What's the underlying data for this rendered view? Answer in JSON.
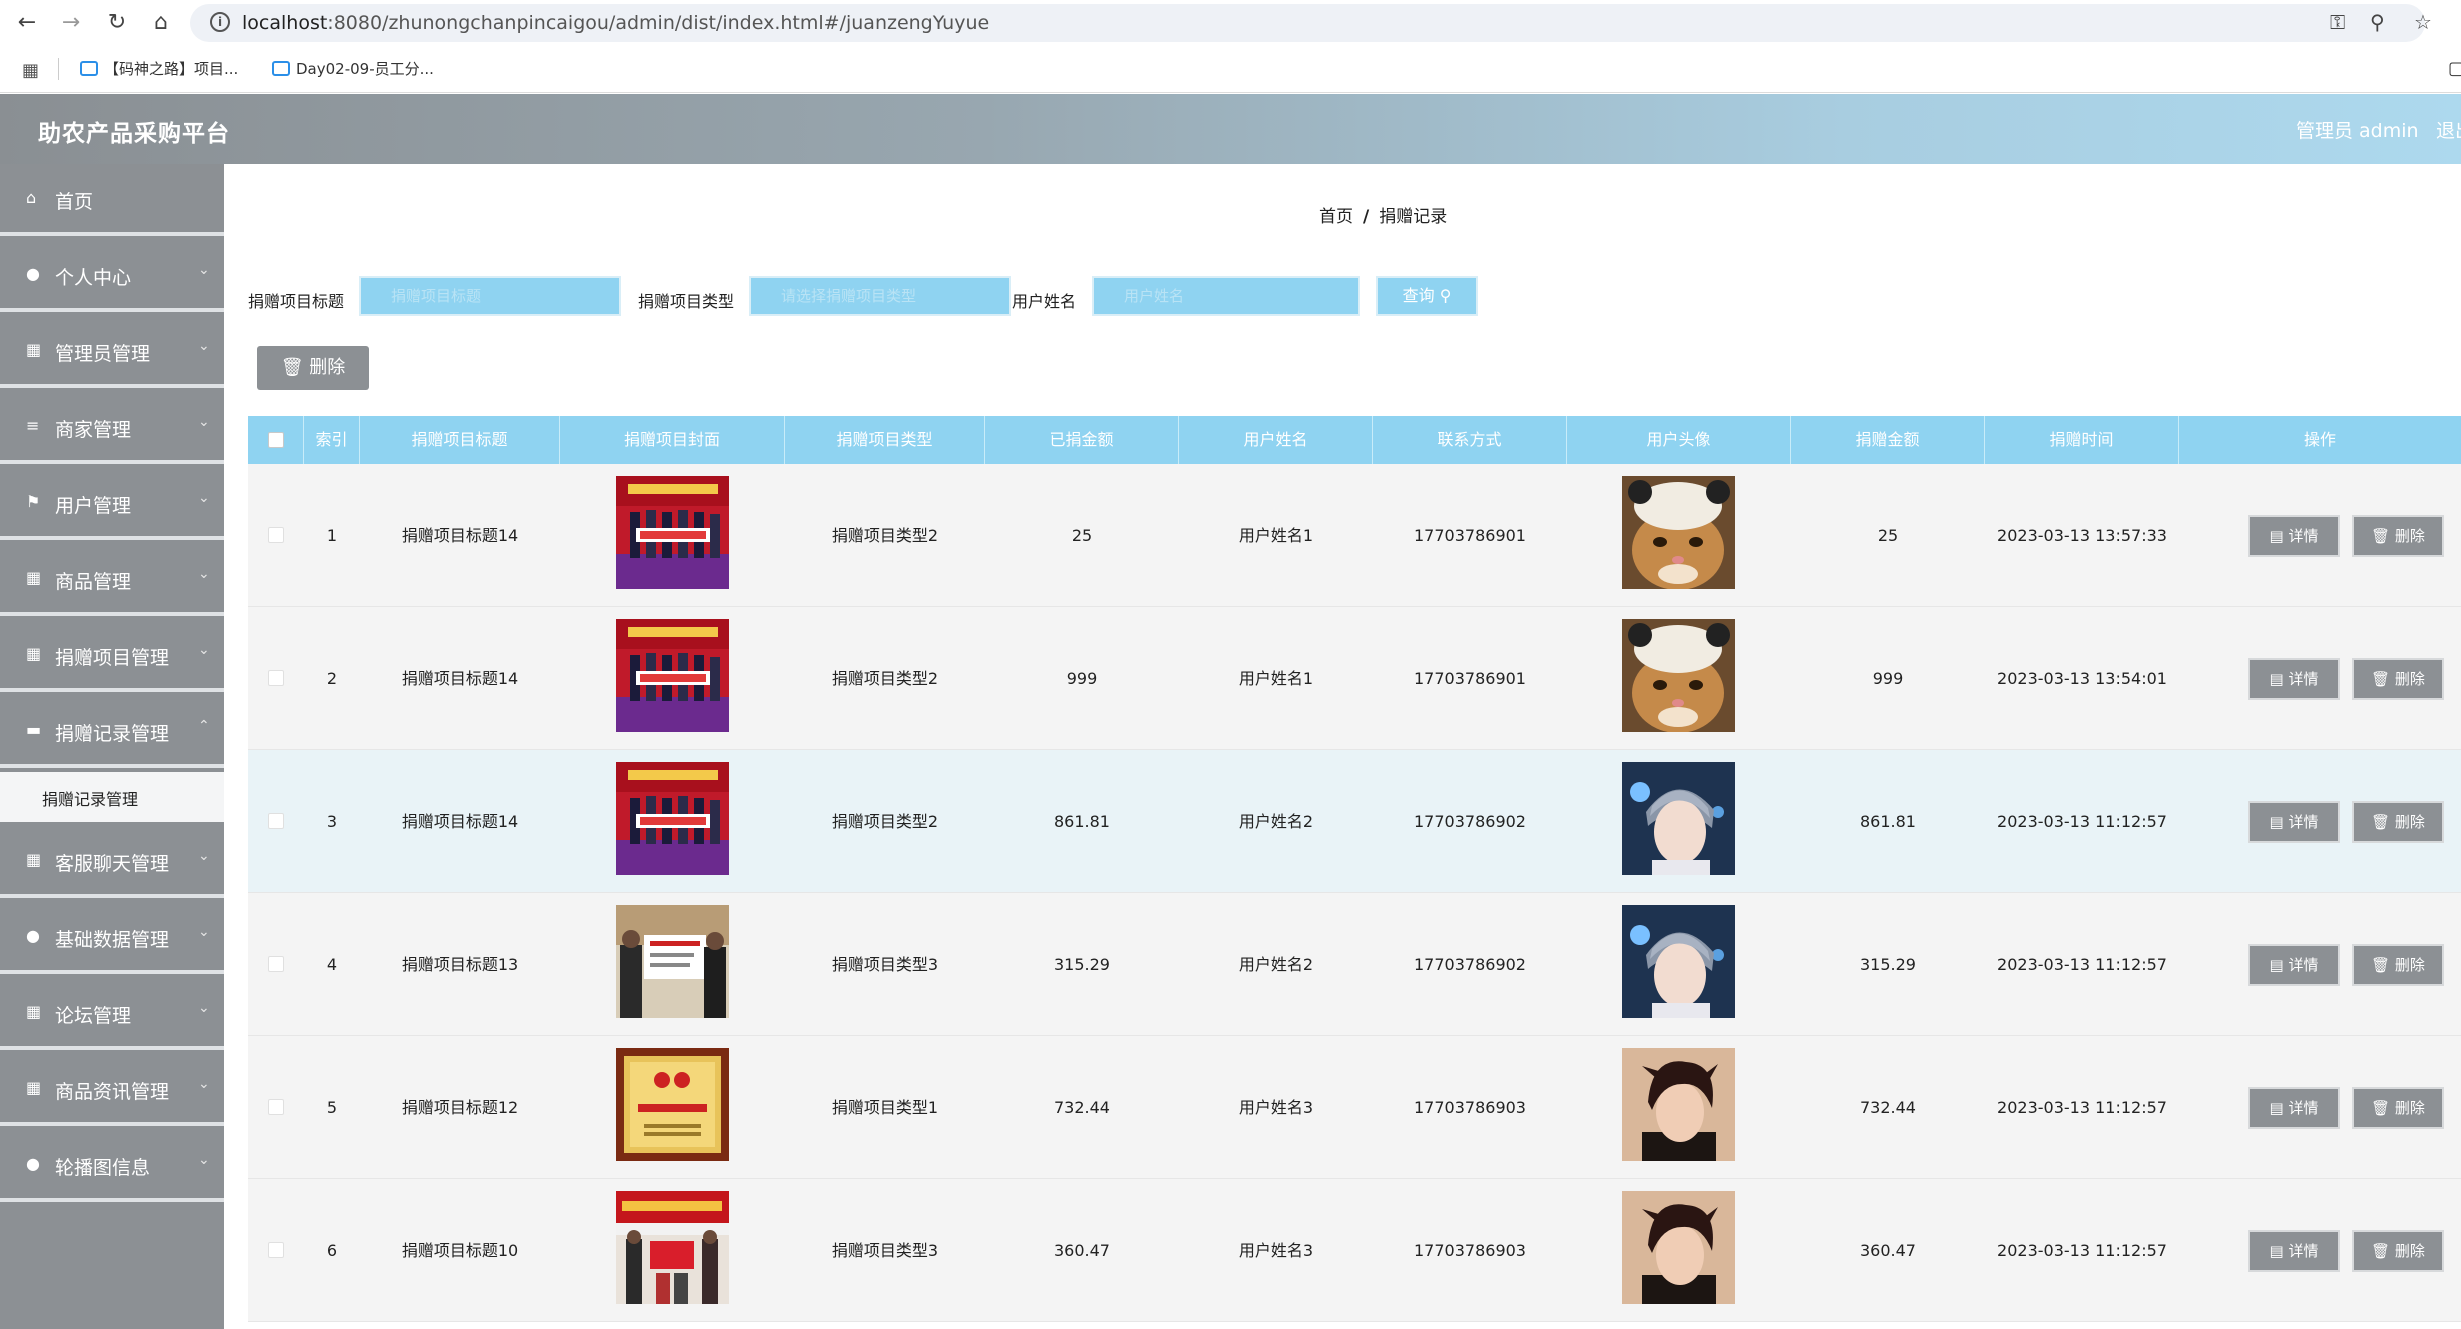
{
  "browser": {
    "url_host": "localhost",
    "url_rest": ":8080/zhunongchanpincaigou/admin/dist/index.html#/juanzengYuyue",
    "bookmarks": [
      "【码神之路】项目...",
      "Day02-09-员工分..."
    ]
  },
  "header": {
    "title": "助农产品采购平台",
    "user": "管理员 admin",
    "logout": "退出"
  },
  "sidebar": {
    "items": [
      {
        "label": "首页",
        "icon": "home-icon"
      },
      {
        "label": "个人中心",
        "icon": "user-icon"
      },
      {
        "label": "管理员管理",
        "icon": "grid-icon"
      },
      {
        "label": "商家管理",
        "icon": "list-icon"
      },
      {
        "label": "用户管理",
        "icon": "flag-icon"
      },
      {
        "label": "商品管理",
        "icon": "grid-icon"
      },
      {
        "label": "捐赠项目管理",
        "icon": "grid-icon"
      },
      {
        "label": "捐赠记录管理",
        "icon": "card-icon"
      },
      {
        "label": "客服聊天管理",
        "icon": "grid-icon"
      },
      {
        "label": "基础数据管理",
        "icon": "user-icon"
      },
      {
        "label": "论坛管理",
        "icon": "grid-icon"
      },
      {
        "label": "商品资讯管理",
        "icon": "grid-icon"
      },
      {
        "label": "轮播图信息",
        "icon": "pin-icon"
      }
    ],
    "submenu_active": "捐赠记录管理"
  },
  "breadcrumb": {
    "home": "首页",
    "current": "捐赠记录"
  },
  "search": {
    "title_label": "捐赠项目标题",
    "title_placeholder": "捐赠项目标题",
    "type_label": "捐赠项目类型",
    "type_placeholder": "请选择捐赠项目类型",
    "name_label": "用户姓名",
    "name_placeholder": "用户姓名",
    "query_button": "查询"
  },
  "toolbar": {
    "delete_button": "删除"
  },
  "table": {
    "headers": [
      "索引",
      "捐赠项目标题",
      "捐赠项目封面",
      "捐赠项目类型",
      "已捐金额",
      "用户姓名",
      "联系方式",
      "用户头像",
      "捐赠金额",
      "捐赠时间",
      "操作"
    ],
    "detail_label": "详情",
    "delete_label": "删除",
    "rows": [
      {
        "index": "1",
        "title": "捐赠项目标题14",
        "type": "捐赠项目类型2",
        "raised": "25",
        "user": "用户姓名1",
        "phone": "17703786901",
        "amount": "25",
        "time": "2023-03-13 13:57:33",
        "cover": "stage",
        "avatar": "cat"
      },
      {
        "index": "2",
        "title": "捐赠项目标题14",
        "type": "捐赠项目类型2",
        "raised": "999",
        "user": "用户姓名1",
        "phone": "17703786901",
        "amount": "999",
        "time": "2023-03-13 13:54:01",
        "cover": "stage",
        "avatar": "cat"
      },
      {
        "index": "3",
        "title": "捐赠项目标题14",
        "type": "捐赠项目类型2",
        "raised": "861.81",
        "user": "用户姓名2",
        "phone": "17703786902",
        "amount": "861.81",
        "time": "2023-03-13 11:12:57",
        "cover": "stage",
        "avatar": "boy-light"
      },
      {
        "index": "4",
        "title": "捐赠项目标题13",
        "type": "捐赠项目类型3",
        "raised": "315.29",
        "user": "用户姓名2",
        "phone": "17703786902",
        "amount": "315.29",
        "time": "2023-03-13 11:12:57",
        "cover": "check",
        "avatar": "boy-light"
      },
      {
        "index": "5",
        "title": "捐赠项目标题12",
        "type": "捐赠项目类型1",
        "raised": "732.44",
        "user": "用户姓名3",
        "phone": "17703786903",
        "amount": "732.44",
        "time": "2023-03-13 11:12:57",
        "cover": "plaque",
        "avatar": "boy-dark"
      },
      {
        "index": "6",
        "title": "捐赠项目标题10",
        "type": "捐赠项目类型3",
        "raised": "360.47",
        "user": "用户姓名3",
        "phone": "17703786903",
        "amount": "360.47",
        "time": "2023-03-13 11:12:57",
        "cover": "banner",
        "avatar": "boy-dark"
      }
    ]
  }
}
